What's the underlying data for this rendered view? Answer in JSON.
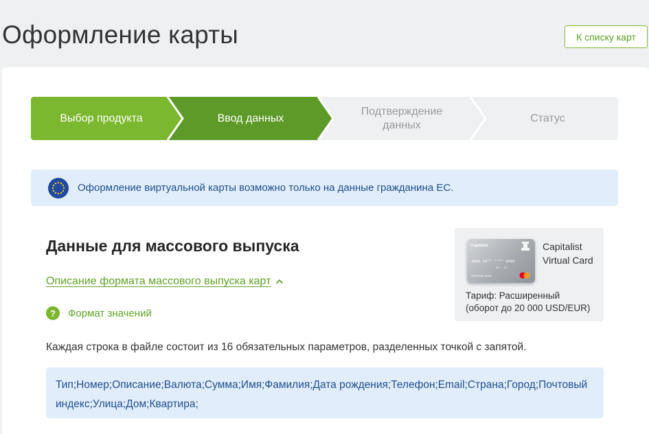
{
  "page": {
    "title": "Оформление карты",
    "back_button": "К списку карт"
  },
  "stepper": {
    "steps": [
      {
        "label": "Выбор продукта",
        "state": "done"
      },
      {
        "label": "Ввод данных",
        "state": "active"
      },
      {
        "label": "Подтверждение данных",
        "state": "pending"
      },
      {
        "label": "Статус",
        "state": "pending"
      }
    ],
    "colors": {
      "done": "#7bb82f",
      "active": "#5e9a28",
      "pending": "#eff0f2"
    }
  },
  "alert": {
    "icon": "eu-flag-icon",
    "text": "Оформление виртуальной карты возможно только на данные гражданина ЕС."
  },
  "section": {
    "title": "Данные для массового выпуска",
    "format_link": "Описание формата массового выпуска карт",
    "values_label": "Формат значений",
    "description": "Каждая строка в файле состоит из 16 обязательных параметров, разделенных точкой с запятой.",
    "format_string": "Тип;Номер;Описание;Валюта;Сумма;Имя;Фамилия;Дата рождения;Телефон;Email;Страна;Город;Почтовый индекс;Улица;Дом;Квартира;"
  },
  "product": {
    "name": "Capitalist Virtual Card",
    "card_brand": "Capitalist",
    "card_number": "4000 00** **** 0000",
    "card_expiry": "04 / 27",
    "card_holder": "PERSONAL NAME",
    "tariff": "Тариф: Расширенный",
    "turnover": "(оборот до 20 000 USD/EUR)"
  },
  "accent_color": "#7bb82f"
}
